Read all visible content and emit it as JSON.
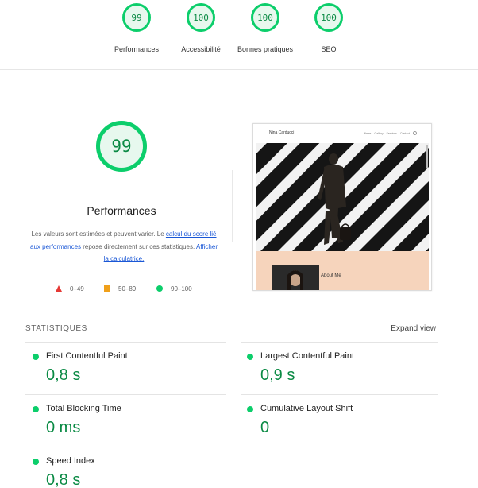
{
  "categories": [
    {
      "score": "99",
      "label": "Performances"
    },
    {
      "score": "100",
      "label": "Accessibilité"
    },
    {
      "score": "100",
      "label": "Bonnes pratiques"
    },
    {
      "score": "100",
      "label": "SEO"
    }
  ],
  "performance": {
    "score": "99",
    "title": "Performances",
    "desc_prefix": "Les valeurs sont estimées et peuvent varier. Le ",
    "link_calc": "calcul du score lié aux performances",
    "desc_middle": " repose directement sur ces statistiques. ",
    "link_calculator": "Afficher la calculatrice.",
    "legend": [
      {
        "shape": "triangle",
        "color": "#e53935",
        "range": "0–49"
      },
      {
        "shape": "square",
        "color": "#f0a01a",
        "range": "50–89"
      },
      {
        "shape": "circle",
        "color": "#0cce6b",
        "range": "90–100"
      }
    ]
  },
  "preview": {
    "site_name": "Nina Carducci",
    "nav_items": [
      "News",
      "Gallery",
      "Services",
      "Contact"
    ],
    "about_label": "About Me"
  },
  "stats": {
    "heading": "STATISTIQUES",
    "expand_label": "Expand view",
    "metrics": [
      {
        "name": "First Contentful Paint",
        "value": "0,8 s"
      },
      {
        "name": "Largest Contentful Paint",
        "value": "0,9 s"
      },
      {
        "name": "Total Blocking Time",
        "value": "0 ms"
      },
      {
        "name": "Cumulative Layout Shift",
        "value": "0"
      },
      {
        "name": "Speed Index",
        "value": "0,8 s"
      }
    ]
  },
  "colors": {
    "pass": "#0cce6b",
    "pass_text": "#0a8a44",
    "average": "#f0a01a",
    "fail": "#e53935",
    "link": "#1a57d6"
  }
}
